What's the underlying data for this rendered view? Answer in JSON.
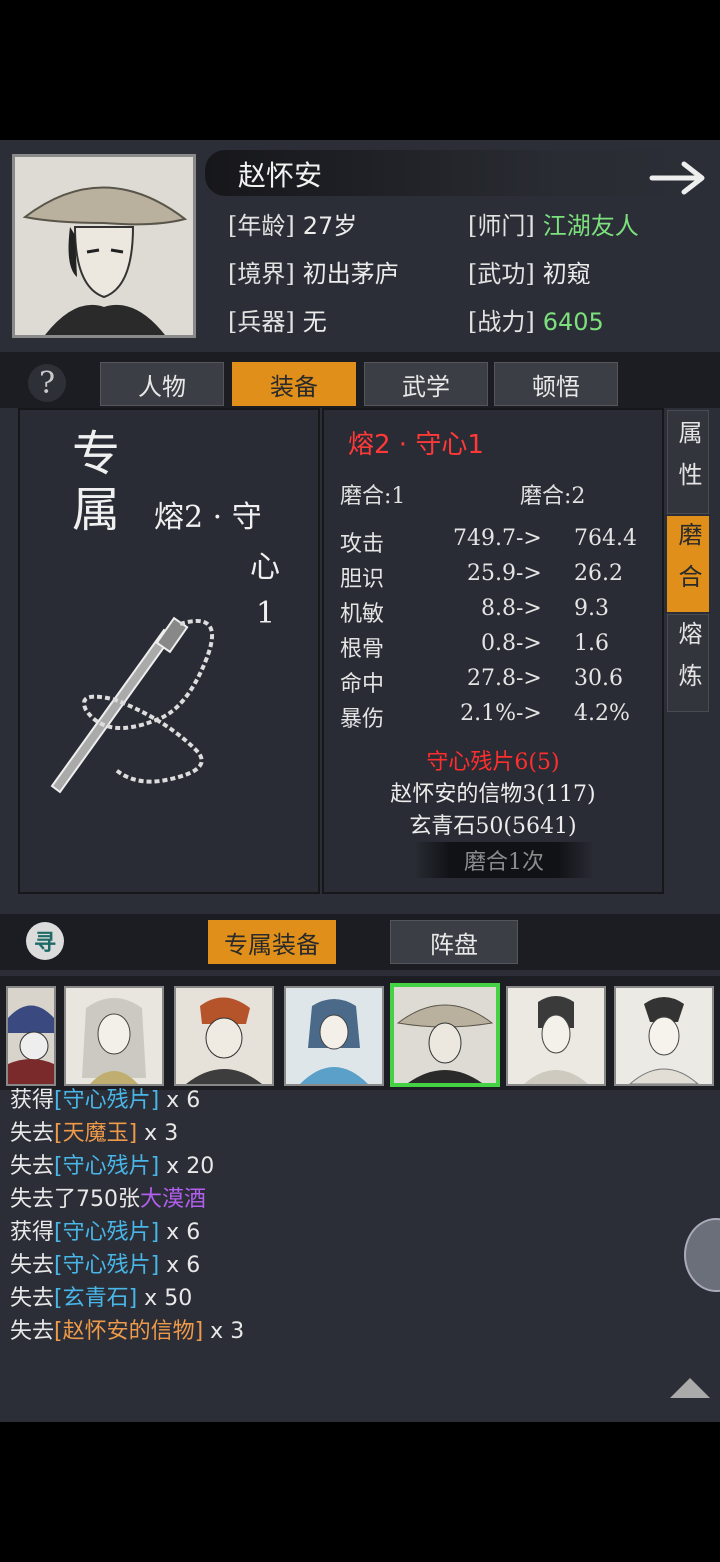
{
  "character": {
    "name": "赵怀安",
    "fields": [
      {
        "key": "[年龄]",
        "value": "27岁"
      },
      {
        "key": "[师门]",
        "value": "江湖友人"
      },
      {
        "key": "[境界]",
        "value": "初出茅庐"
      },
      {
        "key": "[武功]",
        "value": "初窥"
      },
      {
        "key": "[兵器]",
        "value": "无"
      },
      {
        "key": "[战力]",
        "value": "6405"
      }
    ]
  },
  "colors": {
    "accent": "#e0901a",
    "power": "#7ce07c",
    "title_red": "#ff3838",
    "item_orange": "#ee9a4a",
    "item_blue": "#48b6e8",
    "item_purple": "#b25ff0"
  },
  "tabs": [
    "人物",
    "装备",
    "武学",
    "顿悟"
  ],
  "active_tab": "装备",
  "equip": {
    "category": "专属",
    "name_lines": [
      "熔2 · 守",
      "心",
      "1"
    ],
    "title": "熔2 · 守心1",
    "grind_from": "磨合:1",
    "grind_to": "磨合:2",
    "stats": [
      {
        "name": "攻击",
        "from": "749.7",
        "arrow": "->",
        "to": "764.4"
      },
      {
        "name": "胆识",
        "from": "25.9",
        "arrow": "->",
        "to": "26.2"
      },
      {
        "name": "机敏",
        "from": "8.8",
        "arrow": "->",
        "to": "9.3"
      },
      {
        "name": "根骨",
        "from": "0.8",
        "arrow": "->",
        "to": "1.6"
      },
      {
        "name": "命中",
        "from": "27.8",
        "arrow": "->",
        "to": "30.6"
      },
      {
        "name": "暴伤",
        "from": "2.1%",
        "arrow": "->",
        "to": "4.2%"
      }
    ],
    "materials": [
      {
        "text": "守心残片6(5)",
        "insufficient": true
      },
      {
        "text": "赵怀安的信物3(117)",
        "insufficient": false
      },
      {
        "text": "玄青石50(5641)",
        "insufficient": false
      }
    ],
    "grind_button": "磨合1次"
  },
  "side_tabs": [
    {
      "label": "属性",
      "active": false
    },
    {
      "label": "磨合",
      "active": true
    },
    {
      "label": "熔炼",
      "active": false
    }
  ],
  "lower_tabs": [
    "专属装备",
    "阵盘"
  ],
  "search_icon_glyph": "寻",
  "heroes_selected_index": 4,
  "log": [
    {
      "parts": [
        {
          "t": "获得",
          "c": ""
        },
        {
          "t": "[守心残片]",
          "c": "b"
        },
        {
          "t": " x 6",
          "c": ""
        }
      ]
    },
    {
      "parts": [
        {
          "t": "失去",
          "c": ""
        },
        {
          "t": "[天魔玉]",
          "c": "o"
        },
        {
          "t": " x 3",
          "c": ""
        }
      ]
    },
    {
      "parts": [
        {
          "t": "失去",
          "c": ""
        },
        {
          "t": "[守心残片]",
          "c": "b"
        },
        {
          "t": " x 20",
          "c": ""
        }
      ]
    },
    {
      "parts": [
        {
          "t": "失去了750张",
          "c": ""
        },
        {
          "t": "大漠酒",
          "c": "p"
        }
      ]
    },
    {
      "parts": [
        {
          "t": "获得",
          "c": ""
        },
        {
          "t": "[守心残片]",
          "c": "b"
        },
        {
          "t": " x 6",
          "c": ""
        }
      ]
    },
    {
      "parts": [
        {
          "t": "失去",
          "c": ""
        },
        {
          "t": "[守心残片]",
          "c": "b"
        },
        {
          "t": " x 6",
          "c": ""
        }
      ]
    },
    {
      "parts": [
        {
          "t": "失去",
          "c": ""
        },
        {
          "t": "[玄青石]",
          "c": "b"
        },
        {
          "t": " x 50",
          "c": ""
        }
      ]
    },
    {
      "parts": [
        {
          "t": "失去",
          "c": ""
        },
        {
          "t": "[赵怀安的信物]",
          "c": "o"
        },
        {
          "t": " x 3",
          "c": ""
        }
      ]
    }
  ]
}
